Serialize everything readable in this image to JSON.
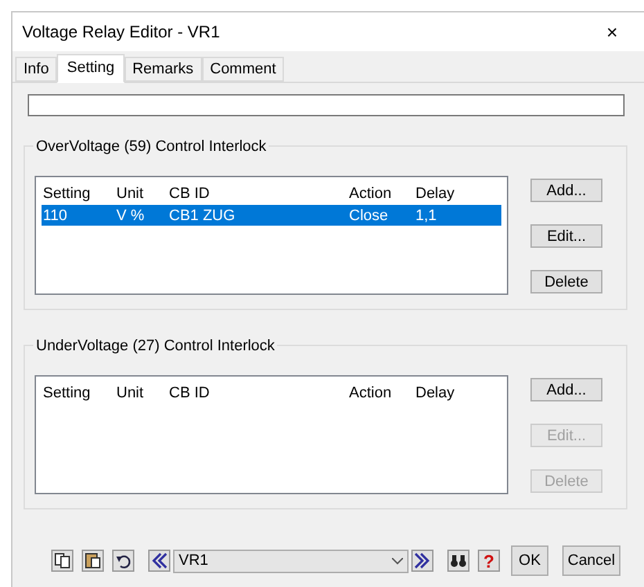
{
  "window": {
    "title": "Voltage Relay Editor - VR1",
    "close": "×"
  },
  "tabs": [
    {
      "label": "Info",
      "selected": false
    },
    {
      "label": "Setting",
      "selected": true
    },
    {
      "label": "Remarks",
      "selected": false
    },
    {
      "label": "Comment",
      "selected": false
    }
  ],
  "groups": [
    {
      "title": "OverVoltage (59) Control Interlock",
      "columns": [
        "Setting",
        "Unit",
        "CB ID",
        "Action",
        "Delay"
      ],
      "rows": [
        {
          "cells": [
            "110",
            "V %",
            "CB1 ZUG",
            "Close",
            "1,1"
          ],
          "selected": true
        }
      ],
      "buttons": [
        {
          "label": "Add...",
          "disabled": false
        },
        {
          "label": "Edit...",
          "disabled": false
        },
        {
          "label": "Delete",
          "disabled": false
        }
      ]
    },
    {
      "title": "UnderVoltage (27) Control Interlock",
      "columns": [
        "Setting",
        "Unit",
        "CB ID",
        "Action",
        "Delay"
      ],
      "buttons": [
        {
          "label": "Add...",
          "disabled": false
        },
        {
          "label": "Edit...",
          "disabled": true
        },
        {
          "label": "Delete",
          "disabled": true
        }
      ]
    }
  ],
  "footer": {
    "combo_value": "VR1",
    "help": "?",
    "buttons": [
      "OK",
      "Cancel"
    ]
  }
}
